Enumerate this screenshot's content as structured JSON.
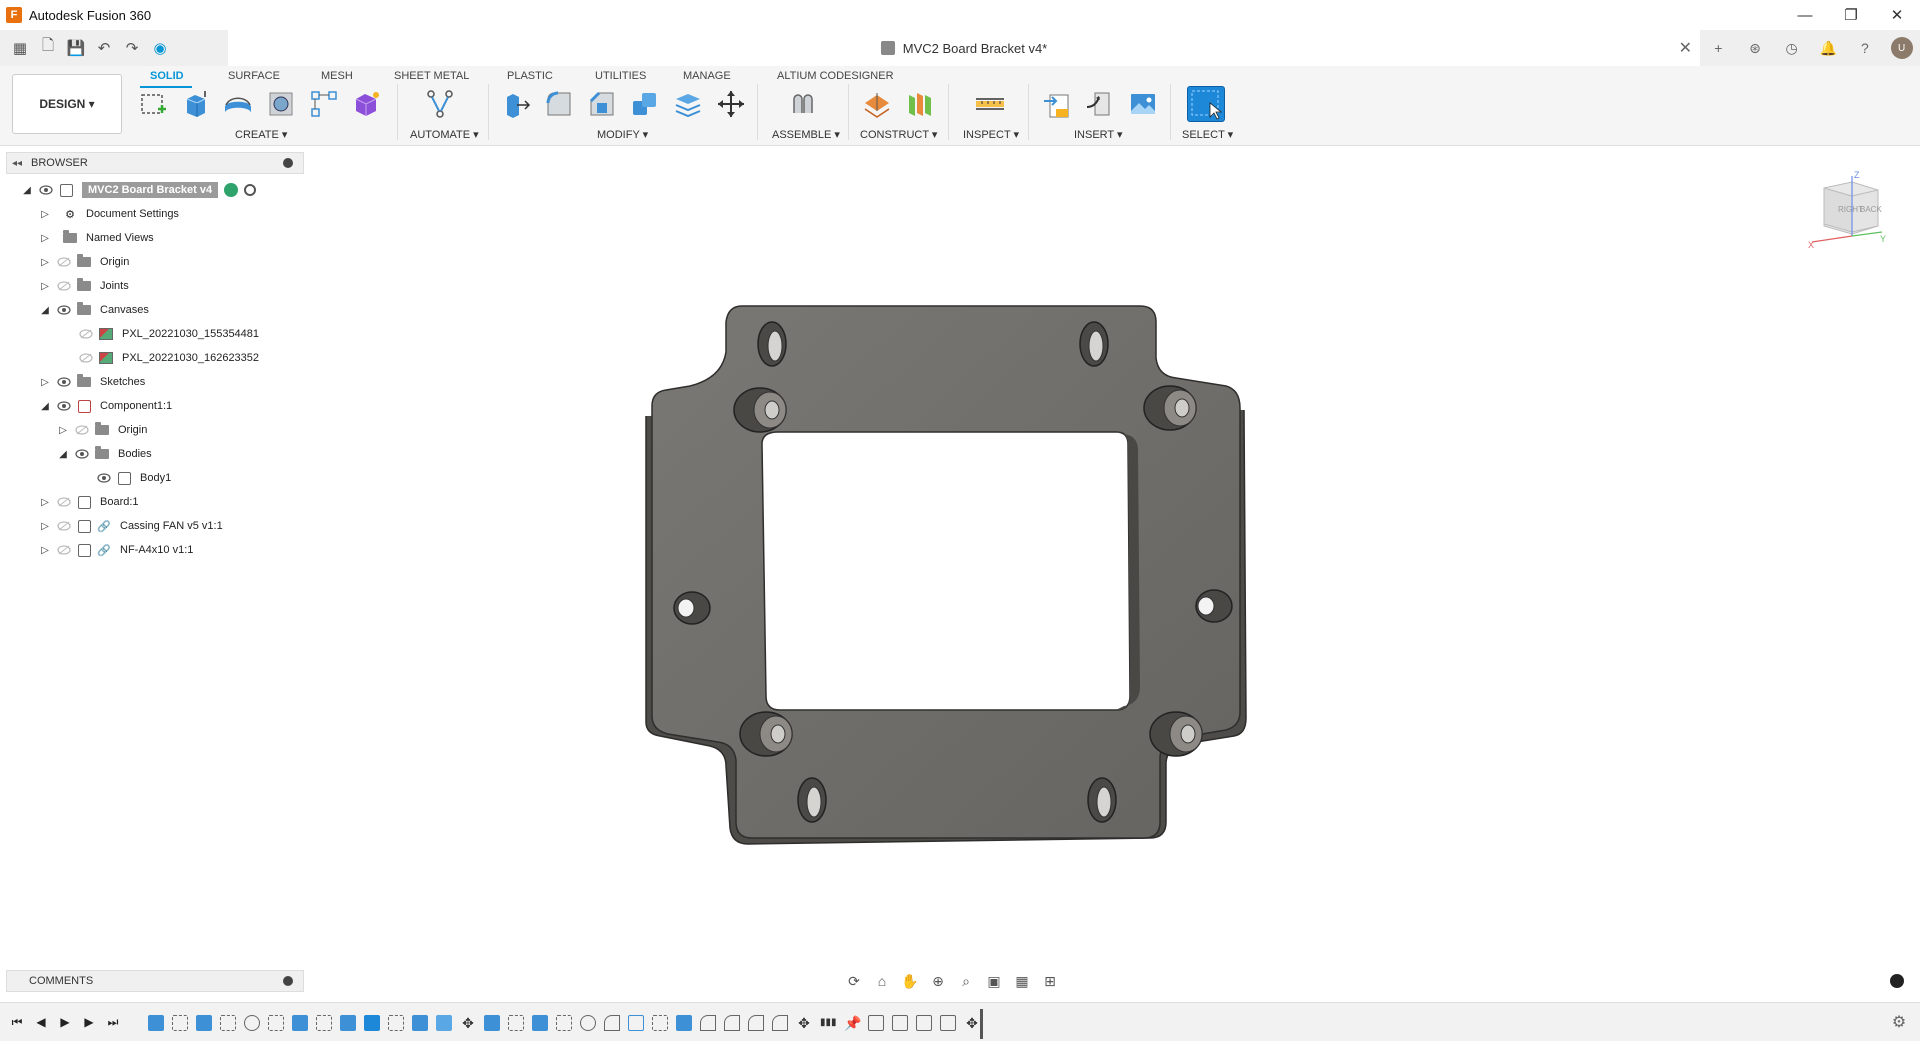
{
  "app": {
    "title": "Autodesk Fusion 360",
    "logo_glyph": "F",
    "document_title": "MVC2 Board Bracket v4*",
    "window_controls": {
      "minimize": "—",
      "restore": "❐",
      "close": "✕"
    }
  },
  "quick_access": {
    "icons": [
      "grid-menu-icon",
      "file-icon",
      "save-icon",
      "undo-icon",
      "redo-icon",
      "job-status-icon"
    ],
    "glyphs": [
      "▦",
      "🗋",
      "💾",
      "↶",
      "↷",
      "◉"
    ],
    "right_icons": [
      "new-tab-icon",
      "extensions-icon",
      "job-history-icon",
      "notifications-icon",
      "help-icon",
      "user-avatar"
    ],
    "right_glyphs": [
      "+",
      "⊛",
      "◷",
      "🔔",
      "?",
      "U"
    ]
  },
  "ribbon": {
    "workspace": "DESIGN",
    "tabs": [
      "SOLID",
      "SURFACE",
      "MESH",
      "SHEET METAL",
      "PLASTIC",
      "UTILITIES",
      "MANAGE",
      "ALTIUM CODESIGNER"
    ],
    "active_tab": "SOLID",
    "groups": [
      {
        "label": "CREATE ▾"
      },
      {
        "label": "AUTOMATE ▾"
      },
      {
        "label": "MODIFY ▾"
      },
      {
        "label": "ASSEMBLE ▾"
      },
      {
        "label": "CONSTRUCT ▾"
      },
      {
        "label": "INSPECT ▾"
      },
      {
        "label": "INSERT ▾"
      },
      {
        "label": "SELECT ▾"
      }
    ]
  },
  "browser": {
    "title": "BROWSER",
    "items": [
      {
        "label": "MVC2 Board Bracket v4"
      },
      {
        "label": "Document Settings"
      },
      {
        "label": "Named Views"
      },
      {
        "label": "Origin"
      },
      {
        "label": "Joints"
      },
      {
        "label": "Canvases"
      },
      {
        "label": "PXL_20221030_155354481"
      },
      {
        "label": "PXL_20221030_162623352"
      },
      {
        "label": "Sketches"
      },
      {
        "label": "Component1:1"
      },
      {
        "label": "Origin"
      },
      {
        "label": "Bodies"
      },
      {
        "label": "Body1"
      },
      {
        "label": "Board:1"
      },
      {
        "label": "Cassing FAN v5 v1:1"
      },
      {
        "label": "NF-A4x10 v1:1"
      }
    ]
  },
  "viewcube": {
    "right": "RIGHT",
    "back": "BACK",
    "z": "Z",
    "x": "X",
    "y": "Y"
  },
  "comments": {
    "title": "COMMENTS"
  },
  "colors": {
    "accent": "#0696d7",
    "part_fill": "#6f6c68",
    "part_edge": "#3a3936"
  }
}
